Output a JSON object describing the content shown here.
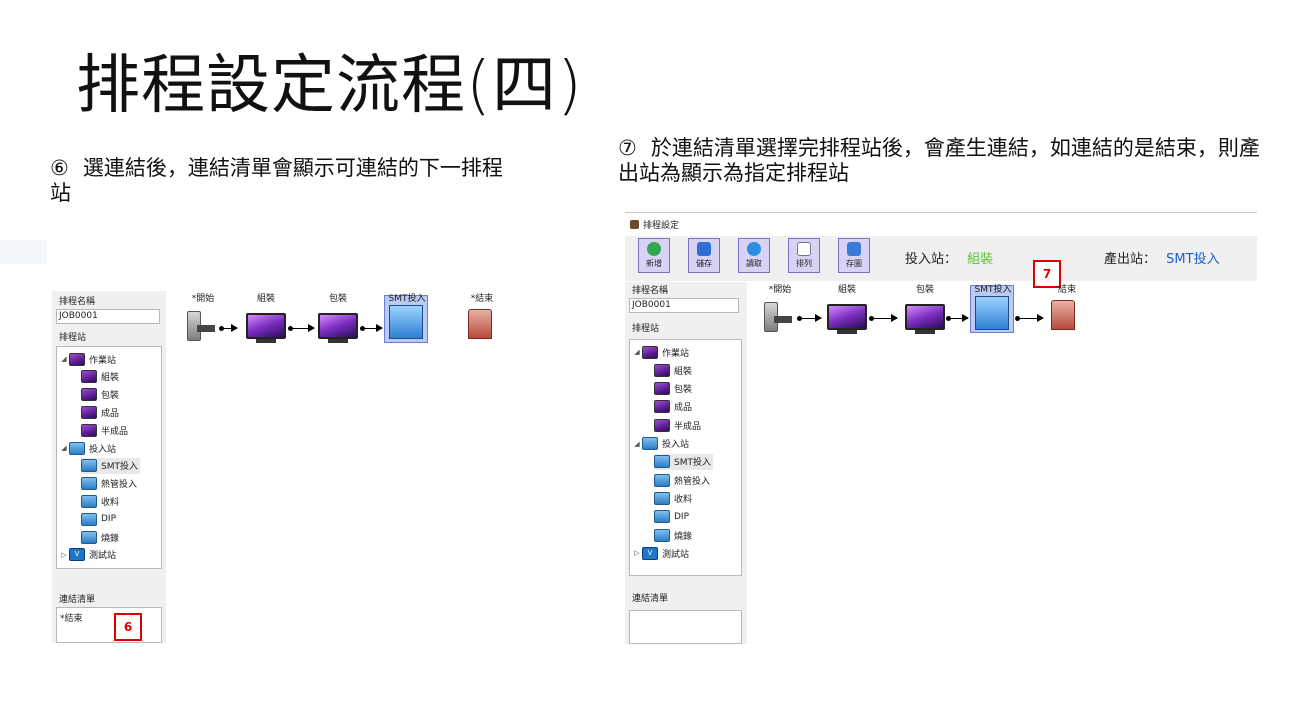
{
  "slide": {
    "title": "排程設定流程(四)",
    "caption_left": {
      "num": "⑥",
      "text": "選連結後，連結清單會顯示可連結的下一排程站"
    },
    "caption_right": {
      "num": "⑦",
      "text": "於連結清單選擇完排程站後，會產生連結，如連結的是結束，則產出站為顯示為指定排程站"
    }
  },
  "left_shot": {
    "name_label": "排程名稱",
    "name_value": "JOB0001",
    "station_label": "排程站",
    "tree": [
      {
        "label": "作業站",
        "icon": "monitor-icon",
        "level": 0,
        "expanded": true
      },
      {
        "label": "組裝",
        "icon": "monitor-icon",
        "level": 1
      },
      {
        "label": "包裝",
        "icon": "monitor-icon",
        "level": 1
      },
      {
        "label": "成品",
        "icon": "monitor-icon",
        "level": 1
      },
      {
        "label": "半成品",
        "icon": "monitor-icon",
        "level": 1
      },
      {
        "label": "投入站",
        "icon": "input-station-icon",
        "level": 0,
        "expanded": true
      },
      {
        "label": "SMT投入",
        "icon": "input-station-icon",
        "level": 1,
        "selected": true
      },
      {
        "label": "熱管投入",
        "icon": "input-station-icon",
        "level": 1
      },
      {
        "label": "收料",
        "icon": "input-station-icon",
        "level": 1
      },
      {
        "label": "DIP",
        "icon": "input-station-icon",
        "level": 1
      },
      {
        "label": "燒錄",
        "icon": "input-station-icon",
        "level": 1
      },
      {
        "label": "測試站",
        "icon": "test-station-icon",
        "level": 0,
        "expanded": false
      }
    ],
    "link_list_label": "連結清單",
    "link_list_items": [
      "*結束"
    ],
    "badge": "6",
    "flow": [
      "*開始",
      "組裝",
      "包裝",
      "SMT投入",
      "*結束"
    ]
  },
  "right_shot": {
    "window_title": "排程設定",
    "toolbar": [
      {
        "label": "新增",
        "icon": "add-icon",
        "color": "#2fa84f"
      },
      {
        "label": "儲存",
        "icon": "save-icon",
        "color": "#2d6fd2"
      },
      {
        "label": "讀取",
        "icon": "refresh-icon",
        "color": "#2a8fe0"
      },
      {
        "label": "排列",
        "icon": "list-icon",
        "color": "#6c7a8a"
      },
      {
        "label": "存圖",
        "icon": "image-icon",
        "color": "#3b7bd8"
      }
    ],
    "input_station_label": "投入站：",
    "input_station_value": "組裝",
    "input_station_color": "#5fbf3a",
    "output_station_label": "產出站：",
    "output_station_value": "SMT投入",
    "output_station_color": "#1d5fd0",
    "name_label": "排程名稱",
    "name_value": "JOB0001",
    "station_label": "排程站",
    "tree": [
      {
        "label": "作業站",
        "icon": "monitor-icon",
        "level": 0,
        "expanded": true
      },
      {
        "label": "組裝",
        "icon": "monitor-icon",
        "level": 1
      },
      {
        "label": "包裝",
        "icon": "monitor-icon",
        "level": 1
      },
      {
        "label": "成品",
        "icon": "monitor-icon",
        "level": 1
      },
      {
        "label": "半成品",
        "icon": "monitor-icon",
        "level": 1
      },
      {
        "label": "投入站",
        "icon": "input-station-icon",
        "level": 0,
        "expanded": true
      },
      {
        "label": "SMT投入",
        "icon": "input-station-icon",
        "level": 1,
        "selected": true
      },
      {
        "label": "熱管投入",
        "icon": "input-station-icon",
        "level": 1
      },
      {
        "label": "收料",
        "icon": "input-station-icon",
        "level": 1
      },
      {
        "label": "DIP",
        "icon": "input-station-icon",
        "level": 1
      },
      {
        "label": "燒錄",
        "icon": "input-station-icon",
        "level": 1
      },
      {
        "label": "測試站",
        "icon": "test-station-icon",
        "level": 0,
        "expanded": false
      }
    ],
    "link_list_label": "連結清單",
    "badge": "7",
    "flow": [
      "*開始",
      "組裝",
      "包裝",
      "SMT投入",
      "結束"
    ]
  }
}
